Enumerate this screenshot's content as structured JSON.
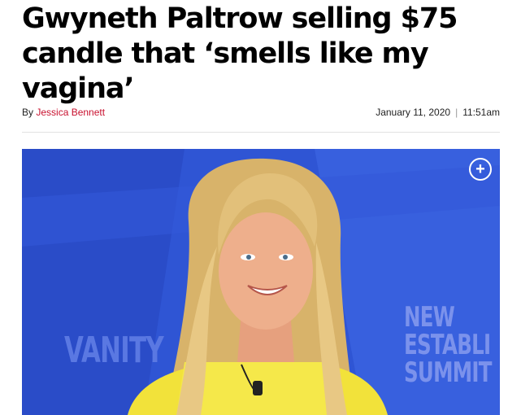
{
  "article": {
    "headline_lines": [
      "Gwyneth Paltrow selling $75",
      "candle that ‘smells like my",
      "vagina’"
    ],
    "byline_prefix": "By",
    "author": "Jessica Bennett",
    "date": "January 11, 2020",
    "time": "11:51am",
    "separator": "|"
  },
  "photo": {
    "expand_symbol": "+",
    "backdrop_lines": [
      "NEW",
      "ESTABLI",
      "SUMMIT"
    ],
    "backdrop_left_word": "VANITY"
  },
  "colors": {
    "author_link": "#c8102e",
    "backdrop_blue": "#2f55d4",
    "dress_yellow": "#f2e23a"
  }
}
